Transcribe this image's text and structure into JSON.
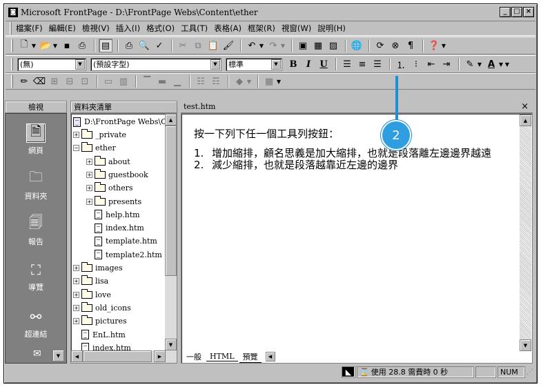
{
  "window": {
    "title": "Microsoft FrontPage - D:\\FrontPage Webs\\Content\\ether",
    "min": "_",
    "max": "□",
    "close": "×"
  },
  "menu": [
    "檔案(F)",
    "編輯(E)",
    "檢視(V)",
    "插入(I)",
    "格式(O)",
    "工具(T)",
    "表格(A)",
    "框架(R)",
    "視窗(W)",
    "說明(H)"
  ],
  "format_bar": {
    "style_value": "(無)",
    "font_value": "(預設字型)",
    "size_value": "標準",
    "bold": "B",
    "italic": "I",
    "underline": "U"
  },
  "views": {
    "header": "檢視",
    "items": [
      {
        "label": "網頁",
        "icon": "page-icon"
      },
      {
        "label": "資料夾",
        "icon": "folder-view-icon"
      },
      {
        "label": "報告",
        "icon": "report-icon"
      },
      {
        "label": "導覽",
        "icon": "navigation-icon"
      },
      {
        "label": "超連結",
        "icon": "hyperlink-icon"
      }
    ]
  },
  "folder_list": {
    "header": "資料夾清單",
    "root": "D:\\FrontPage Webs\\Cor",
    "items": [
      {
        "label": "_private",
        "type": "folder",
        "expander": "+"
      },
      {
        "label": "ether",
        "type": "folder-open",
        "expander": "−"
      },
      {
        "label": "about",
        "type": "folder",
        "expander": "+"
      },
      {
        "label": "guestbook",
        "type": "folder",
        "expander": "+"
      },
      {
        "label": "others",
        "type": "folder",
        "expander": "+"
      },
      {
        "label": "presents",
        "type": "folder",
        "expander": "+"
      },
      {
        "label": "help.htm",
        "type": "file",
        "expander": ""
      },
      {
        "label": "index.htm",
        "type": "file",
        "expander": ""
      },
      {
        "label": "template.htm",
        "type": "file",
        "expander": ""
      },
      {
        "label": "template2.htm",
        "type": "file",
        "expander": ""
      },
      {
        "label": "images",
        "type": "folder",
        "expander": "+"
      },
      {
        "label": "lisa",
        "type": "folder",
        "expander": "+"
      },
      {
        "label": "love",
        "type": "folder",
        "expander": "+"
      },
      {
        "label": "old_icons",
        "type": "folder",
        "expander": "+"
      },
      {
        "label": "pictures",
        "type": "folder",
        "expander": "+"
      },
      {
        "label": "EnL.htm",
        "type": "file",
        "expander": ""
      },
      {
        "label": "index.htm",
        "type": "file",
        "expander": ""
      }
    ]
  },
  "editor": {
    "tab_title": "test.htm",
    "close": "×",
    "intro": "按一下列下任一個工具列按鈕：",
    "list": [
      {
        "num": "1.",
        "text": "增加縮排，顧名思義是加大縮排，也就是段落離左邊邊界越遠"
      },
      {
        "num": "2.",
        "text": "減少縮排，也就是段落越靠近左邊的邊界"
      }
    ],
    "bottom_tabs": [
      "一般",
      "HTML",
      "預覽"
    ]
  },
  "status": {
    "timing": "使用 28.8 需費時 0 秒",
    "numlock": "NUM"
  },
  "callout": {
    "label": "2",
    "color": "#2f9ee0"
  }
}
